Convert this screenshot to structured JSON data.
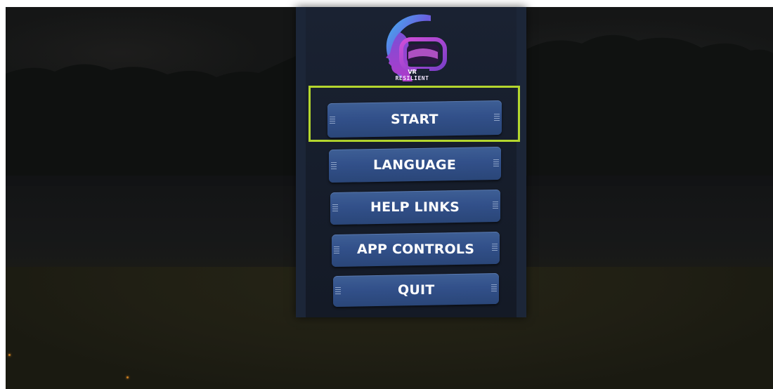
{
  "app": {
    "logo_small": "VR",
    "logo_name": "RESILIENT"
  },
  "menu": {
    "selected": "start",
    "highlight_color": "#b4d62e",
    "button_color": "#34548c",
    "items": [
      {
        "id": "start",
        "label": "START"
      },
      {
        "id": "language",
        "label": "LANGUAGE"
      },
      {
        "id": "help-links",
        "label": "HELP LINKS"
      },
      {
        "id": "app-controls",
        "label": "APP CONTROLS"
      },
      {
        "id": "quit",
        "label": "QUIT"
      }
    ]
  },
  "icons": {
    "logo": "vr-headset-head-logo-icon",
    "grip": "grip-lines-icon"
  }
}
